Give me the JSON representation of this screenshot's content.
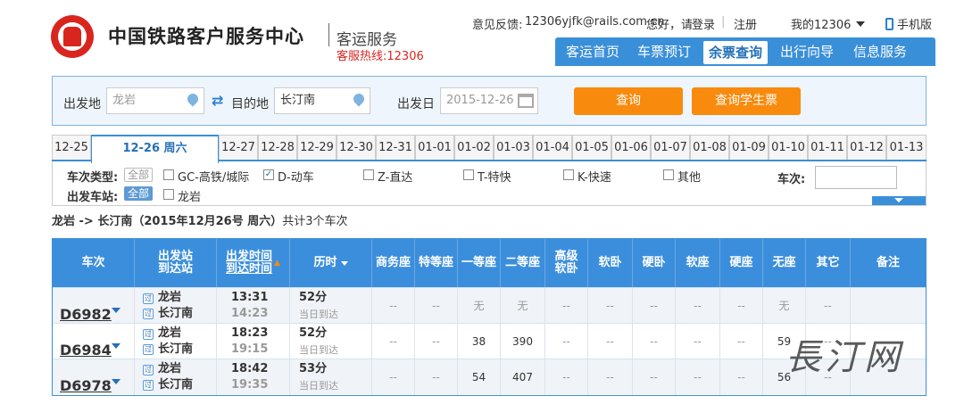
{
  "header": {
    "site_title": "中国铁路客户服务中心",
    "site_sub": "客运服务",
    "hotline": "客服热线:12306",
    "feedback_label": "意见反馈:",
    "feedback_email": "12306yjfk@rails.com.cn",
    "greeting": "您好，请",
    "login": "登录",
    "register": "注册",
    "my12306": "我的12306",
    "mobile": "手机版"
  },
  "nav": {
    "items": [
      "客运首页",
      "车票预订",
      "余票查询",
      "出行向导",
      "信息服务"
    ],
    "active": "余票查询"
  },
  "search": {
    "from_label": "出发地",
    "from_value": "龙岩",
    "to_label": "目的地",
    "to_value": "长汀南",
    "date_label": "出发日",
    "date_value": "2015-12-26",
    "query_button": "查询",
    "student_button": "查询学生票"
  },
  "dates": [
    "12-25",
    "12-26 周六",
    "12-27",
    "12-28",
    "12-29",
    "12-30",
    "12-31",
    "01-01",
    "01-02",
    "01-03",
    "01-04",
    "01-05",
    "01-06",
    "01-07",
    "01-08",
    "01-09",
    "01-10",
    "01-11",
    "01-12",
    "01-13"
  ],
  "filters": {
    "type_label": "车次类型:",
    "all": "全部",
    "types": [
      "GC-高铁/城际",
      "D-动车",
      "Z-直达",
      "T-特快",
      "K-快速",
      "其他"
    ],
    "station_label": "出发车站:",
    "stations": [
      "龙岩"
    ],
    "train_no_label": "车次:"
  },
  "summary": {
    "route": "龙岩 -> 长汀南（2015年12月26号  周六）",
    "count": "共计3个车次"
  },
  "table": {
    "headers": [
      "车次",
      "出发站\n到达站",
      "出发时间\n到达时间",
      "历时",
      "商务座",
      "特等座",
      "一等座",
      "二等座",
      "高级\n软卧",
      "软卧",
      "硬卧",
      "软座",
      "硬座",
      "无座",
      "其它",
      "备注"
    ],
    "rows": [
      {
        "train": "D6982",
        "from": "龙岩",
        "to": "长汀南",
        "dep": "13:31",
        "arr": "14:23",
        "dur": "52分",
        "arrival_note": "当日到达",
        "seats": [
          "--",
          "--",
          "无",
          "无",
          "--",
          "--",
          "--",
          "--",
          "--",
          "无",
          "--"
        ]
      },
      {
        "train": "D6984",
        "from": "龙岩",
        "to": "长汀南",
        "dep": "18:23",
        "arr": "19:15",
        "dur": "52分",
        "arrival_note": "当日到达",
        "seats": [
          "--",
          "--",
          "38",
          "390",
          "--",
          "--",
          "--",
          "--",
          "--",
          "59",
          "--"
        ]
      },
      {
        "train": "D6978",
        "from": "龙岩",
        "to": "长汀南",
        "dep": "18:42",
        "arr": "19:35",
        "dur": "53分",
        "arrival_note": "当日到达",
        "seats": [
          "--",
          "--",
          "54",
          "407",
          "--",
          "--",
          "--",
          "--",
          "--",
          "56",
          "--"
        ]
      }
    ],
    "badge_from": "过",
    "badge_to": "过"
  },
  "watermark": "長汀网"
}
